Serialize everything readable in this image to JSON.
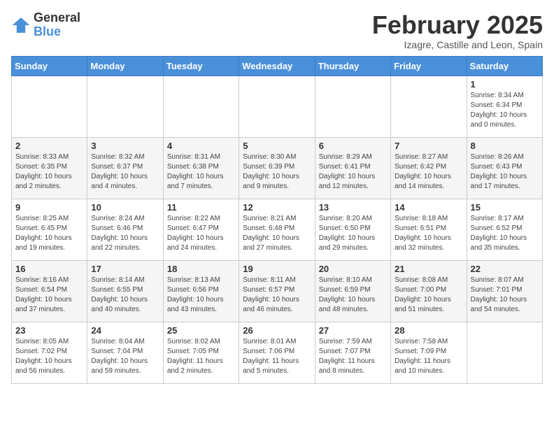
{
  "logo": {
    "general": "General",
    "blue": "Blue"
  },
  "title": "February 2025",
  "subtitle": "Izagre, Castille and Leon, Spain",
  "weekdays": [
    "Sunday",
    "Monday",
    "Tuesday",
    "Wednesday",
    "Thursday",
    "Friday",
    "Saturday"
  ],
  "weeks": [
    [
      {
        "day": "",
        "info": ""
      },
      {
        "day": "",
        "info": ""
      },
      {
        "day": "",
        "info": ""
      },
      {
        "day": "",
        "info": ""
      },
      {
        "day": "",
        "info": ""
      },
      {
        "day": "",
        "info": ""
      },
      {
        "day": "1",
        "info": "Sunrise: 8:34 AM\nSunset: 6:34 PM\nDaylight: 10 hours\nand 0 minutes."
      }
    ],
    [
      {
        "day": "2",
        "info": "Sunrise: 8:33 AM\nSunset: 6:35 PM\nDaylight: 10 hours\nand 2 minutes."
      },
      {
        "day": "3",
        "info": "Sunrise: 8:32 AM\nSunset: 6:37 PM\nDaylight: 10 hours\nand 4 minutes."
      },
      {
        "day": "4",
        "info": "Sunrise: 8:31 AM\nSunset: 6:38 PM\nDaylight: 10 hours\nand 7 minutes."
      },
      {
        "day": "5",
        "info": "Sunrise: 8:30 AM\nSunset: 6:39 PM\nDaylight: 10 hours\nand 9 minutes."
      },
      {
        "day": "6",
        "info": "Sunrise: 8:29 AM\nSunset: 6:41 PM\nDaylight: 10 hours\nand 12 minutes."
      },
      {
        "day": "7",
        "info": "Sunrise: 8:27 AM\nSunset: 6:42 PM\nDaylight: 10 hours\nand 14 minutes."
      },
      {
        "day": "8",
        "info": "Sunrise: 8:26 AM\nSunset: 6:43 PM\nDaylight: 10 hours\nand 17 minutes."
      }
    ],
    [
      {
        "day": "9",
        "info": "Sunrise: 8:25 AM\nSunset: 6:45 PM\nDaylight: 10 hours\nand 19 minutes."
      },
      {
        "day": "10",
        "info": "Sunrise: 8:24 AM\nSunset: 6:46 PM\nDaylight: 10 hours\nand 22 minutes."
      },
      {
        "day": "11",
        "info": "Sunrise: 8:22 AM\nSunset: 6:47 PM\nDaylight: 10 hours\nand 24 minutes."
      },
      {
        "day": "12",
        "info": "Sunrise: 8:21 AM\nSunset: 6:48 PM\nDaylight: 10 hours\nand 27 minutes."
      },
      {
        "day": "13",
        "info": "Sunrise: 8:20 AM\nSunset: 6:50 PM\nDaylight: 10 hours\nand 29 minutes."
      },
      {
        "day": "14",
        "info": "Sunrise: 8:18 AM\nSunset: 6:51 PM\nDaylight: 10 hours\nand 32 minutes."
      },
      {
        "day": "15",
        "info": "Sunrise: 8:17 AM\nSunset: 6:52 PM\nDaylight: 10 hours\nand 35 minutes."
      }
    ],
    [
      {
        "day": "16",
        "info": "Sunrise: 8:16 AM\nSunset: 6:54 PM\nDaylight: 10 hours\nand 37 minutes."
      },
      {
        "day": "17",
        "info": "Sunrise: 8:14 AM\nSunset: 6:55 PM\nDaylight: 10 hours\nand 40 minutes."
      },
      {
        "day": "18",
        "info": "Sunrise: 8:13 AM\nSunset: 6:56 PM\nDaylight: 10 hours\nand 43 minutes."
      },
      {
        "day": "19",
        "info": "Sunrise: 8:11 AM\nSunset: 6:57 PM\nDaylight: 10 hours\nand 46 minutes."
      },
      {
        "day": "20",
        "info": "Sunrise: 8:10 AM\nSunset: 6:59 PM\nDaylight: 10 hours\nand 48 minutes."
      },
      {
        "day": "21",
        "info": "Sunrise: 8:08 AM\nSunset: 7:00 PM\nDaylight: 10 hours\nand 51 minutes."
      },
      {
        "day": "22",
        "info": "Sunrise: 8:07 AM\nSunset: 7:01 PM\nDaylight: 10 hours\nand 54 minutes."
      }
    ],
    [
      {
        "day": "23",
        "info": "Sunrise: 8:05 AM\nSunset: 7:02 PM\nDaylight: 10 hours\nand 56 minutes."
      },
      {
        "day": "24",
        "info": "Sunrise: 8:04 AM\nSunset: 7:04 PM\nDaylight: 10 hours\nand 59 minutes."
      },
      {
        "day": "25",
        "info": "Sunrise: 8:02 AM\nSunset: 7:05 PM\nDaylight: 11 hours\nand 2 minutes."
      },
      {
        "day": "26",
        "info": "Sunrise: 8:01 AM\nSunset: 7:06 PM\nDaylight: 11 hours\nand 5 minutes."
      },
      {
        "day": "27",
        "info": "Sunrise: 7:59 AM\nSunset: 7:07 PM\nDaylight: 11 hours\nand 8 minutes."
      },
      {
        "day": "28",
        "info": "Sunrise: 7:58 AM\nSunset: 7:09 PM\nDaylight: 11 hours\nand 10 minutes."
      },
      {
        "day": "",
        "info": ""
      }
    ]
  ]
}
